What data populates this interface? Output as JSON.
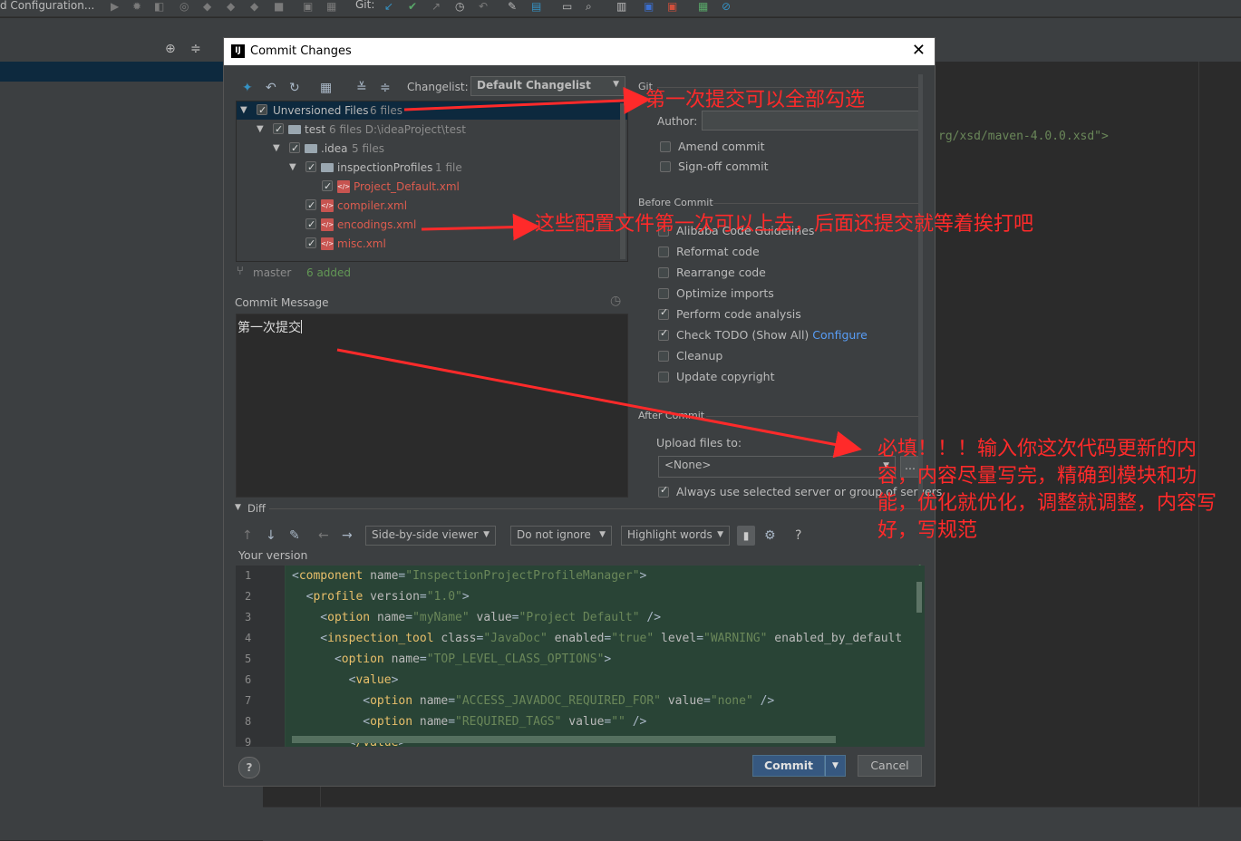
{
  "ide": {
    "run_config": "d Configuration...",
    "git_label": "Git:",
    "bg_xml_text": "rg/xsd/maven-4.0.0.xsd\">"
  },
  "dialog": {
    "title": "Commit Changes",
    "changelist_label": "Changelist:",
    "changelist_value": "Default Changelist",
    "tree": [
      {
        "name": "Unversioned Files",
        "meta": "6 files"
      },
      {
        "name": "test",
        "meta": "6 files  D:\\ideaProject\\test"
      },
      {
        "name": ".idea",
        "meta": "5 files"
      },
      {
        "name": "inspectionProfiles",
        "meta": "1 file"
      },
      {
        "name": "Project_Default.xml"
      },
      {
        "name": "compiler.xml"
      },
      {
        "name": "encodings.xml"
      },
      {
        "name": "misc.xml"
      }
    ],
    "branch": "master",
    "added": "6 added",
    "commit_message_label": "Commit Message",
    "commit_message": "第一次提交",
    "git": {
      "section": "Git",
      "author_label": "Author:",
      "amend": "Amend commit",
      "signoff": "Sign-off commit"
    },
    "before_commit": {
      "section": "Before Commit",
      "items": [
        {
          "label": "Alibaba Code Guidelines",
          "checked": false
        },
        {
          "label": "Reformat code",
          "checked": false
        },
        {
          "label": "Rearrange code",
          "checked": false
        },
        {
          "label": "Optimize imports",
          "checked": false
        },
        {
          "label": "Perform code analysis",
          "checked": true
        },
        {
          "label": "Check TODO (Show All)",
          "checked": true,
          "link": "Configure"
        },
        {
          "label": "Cleanup",
          "checked": false
        },
        {
          "label": "Update copyright",
          "checked": false
        }
      ]
    },
    "after_commit": {
      "section": "After Commit",
      "upload_label": "Upload files to:",
      "upload_value": "<None>",
      "browse": "...",
      "always_use": "Always use selected server or group of servers"
    },
    "diff": {
      "section": "Diff",
      "viewer": "Side-by-side viewer",
      "ignore": "Do not ignore",
      "highlight": "Highlight words",
      "help": "?",
      "your_version": "Your version",
      "lines": [
        {
          "n": "1",
          "indent": "",
          "tag": "component",
          "attrs": [
            [
              "name",
              "\"InspectionProjectProfileManager\""
            ]
          ],
          "end": ">"
        },
        {
          "n": "2",
          "indent": "  ",
          "tag": "profile",
          "attrs": [
            [
              "version",
              "\"1.0\""
            ]
          ],
          "end": ">"
        },
        {
          "n": "3",
          "indent": "    ",
          "tag": "option",
          "attrs": [
            [
              "name",
              "\"myName\""
            ],
            [
              "value",
              "\"Project Default\""
            ]
          ],
          "end": " />"
        },
        {
          "n": "4",
          "indent": "    ",
          "tag": "inspection_tool",
          "attrs": [
            [
              "class",
              "\"JavaDoc\""
            ],
            [
              "enabled",
              "\"true\""
            ],
            [
              "level",
              "\"WARNING\""
            ],
            [
              "enabled_by_default",
              ""
            ]
          ],
          "end": ""
        },
        {
          "n": "5",
          "indent": "      ",
          "tag": "option",
          "attrs": [
            [
              "name",
              "\"TOP_LEVEL_CLASS_OPTIONS\""
            ]
          ],
          "end": ">"
        },
        {
          "n": "6",
          "indent": "        ",
          "tag": "value",
          "attrs": [],
          "end": ">"
        },
        {
          "n": "7",
          "indent": "          ",
          "tag": "option",
          "attrs": [
            [
              "name",
              "\"ACCESS_JAVADOC_REQUIRED_FOR\""
            ],
            [
              "value",
              "\"none\""
            ]
          ],
          "end": " />"
        },
        {
          "n": "8",
          "indent": "          ",
          "tag": "option",
          "attrs": [
            [
              "name",
              "\"REQUIRED_TAGS\""
            ],
            [
              "value",
              "\"\""
            ]
          ],
          "end": " />"
        },
        {
          "n": "9",
          "indent": "        ",
          "tag": "/value",
          "attrs": [],
          "end": ">"
        }
      ]
    },
    "buttons": {
      "commit": "Commit",
      "cancel": "Cancel",
      "help": "?"
    }
  },
  "annotations": {
    "a1": "第一次提交可以全部勾选",
    "a2": "这些配置文件第一次可以上去，后面还提交就等着挨打吧",
    "a3": "必填！！！输入你这次代码更新的内容，内容尽量写完，精确到模块和功能，优化就优化，调整就调整，内容写好，写规范"
  },
  "colors": {
    "accent": "#365880",
    "annotation": "#ff2a2a",
    "diff_bg": "#294436"
  }
}
